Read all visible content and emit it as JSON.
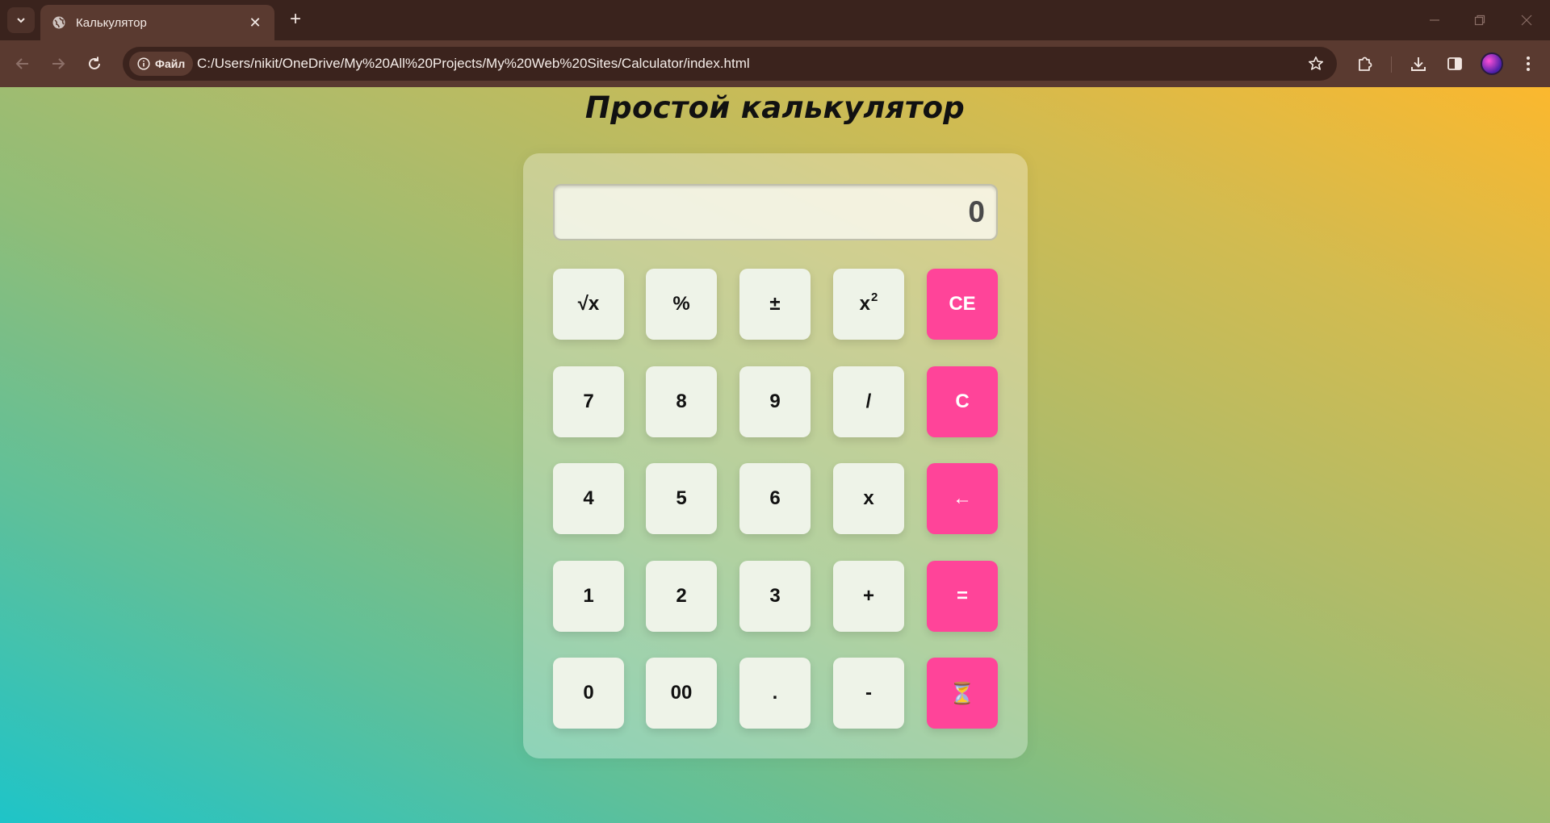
{
  "browser": {
    "tab": {
      "title": "Калькулятор"
    },
    "new_tab_label": "+",
    "site_info_label": "Файл",
    "url": "C:/Users/nikit/OneDrive/My%20All%20Projects/My%20Web%20Sites/Calculator/index.html",
    "icons": {
      "tab_list": "chevron-down-icon",
      "favicon": "globe-icon",
      "back": "arrow-left-icon",
      "forward": "arrow-right-icon",
      "reload": "reload-icon",
      "bookmark": "star-icon",
      "extensions": "puzzle-icon",
      "downloads": "download-icon",
      "side_panel": "side-panel-icon"
    }
  },
  "page": {
    "title": "Простой калькулятор",
    "display_value": "0",
    "colors": {
      "accent": "#ff4499",
      "key_background": "#eef3e8",
      "gradient_start": "#1ec4c8",
      "gradient_end": "#fbb82e"
    },
    "keys": {
      "sqrt": "√x",
      "percent": "%",
      "plus_minus": "±",
      "square_base": "x",
      "square_exp": "2",
      "clear_entry": "CE",
      "seven": "7",
      "eight": "8",
      "nine": "9",
      "divide": "/",
      "clear": "C",
      "four": "4",
      "five": "5",
      "six": "6",
      "multiply": "x",
      "backspace": "←",
      "one": "1",
      "two": "2",
      "three": "3",
      "plus": "+",
      "equals": "=",
      "zero": "0",
      "double_zero": "00",
      "decimal": ".",
      "minus": "-",
      "history": "⏳"
    }
  }
}
